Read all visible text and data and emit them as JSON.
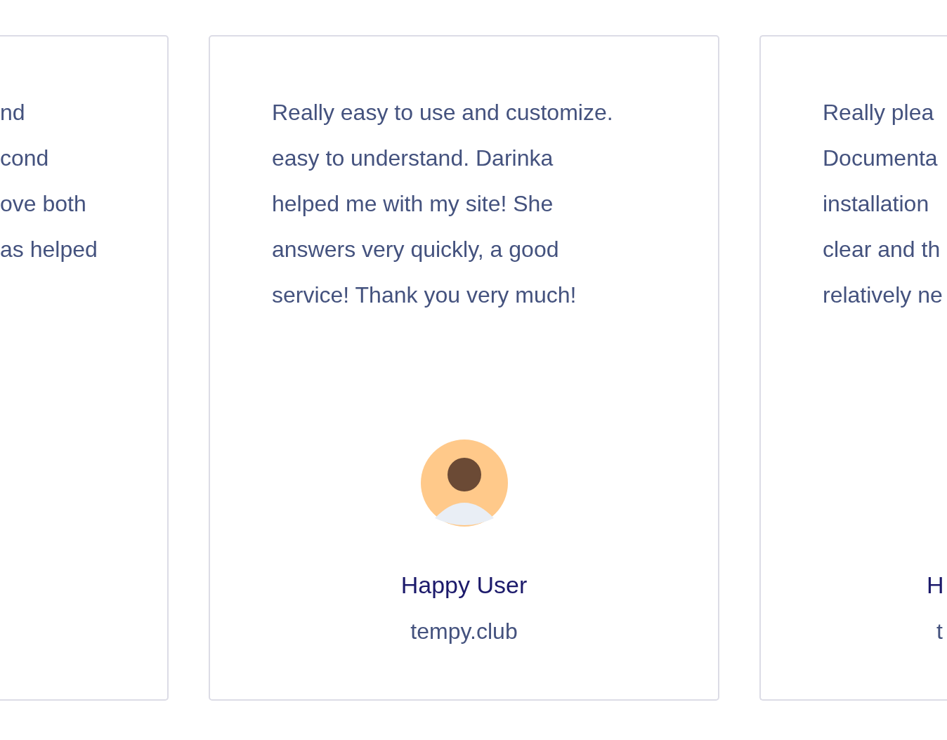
{
  "testimonials": [
    {
      "kind": "cut-left",
      "lines": [
        "nd",
        "cond",
        "ove both",
        "as helped"
      ]
    },
    {
      "kind": "full",
      "lines": [
        "Really easy to use and customize.",
        "easy to understand. Darinka",
        "helped me with my site! She",
        "answers very quickly, a good",
        "service! Thank you very much!"
      ],
      "avatar": true,
      "name": "Happy User",
      "site": "tempy.club"
    },
    {
      "kind": "cut-right",
      "lines": [
        "Really plea",
        "Documenta",
        "installation",
        "clear and th",
        "relatively ne"
      ],
      "name": "H",
      "site": "t"
    }
  ]
}
